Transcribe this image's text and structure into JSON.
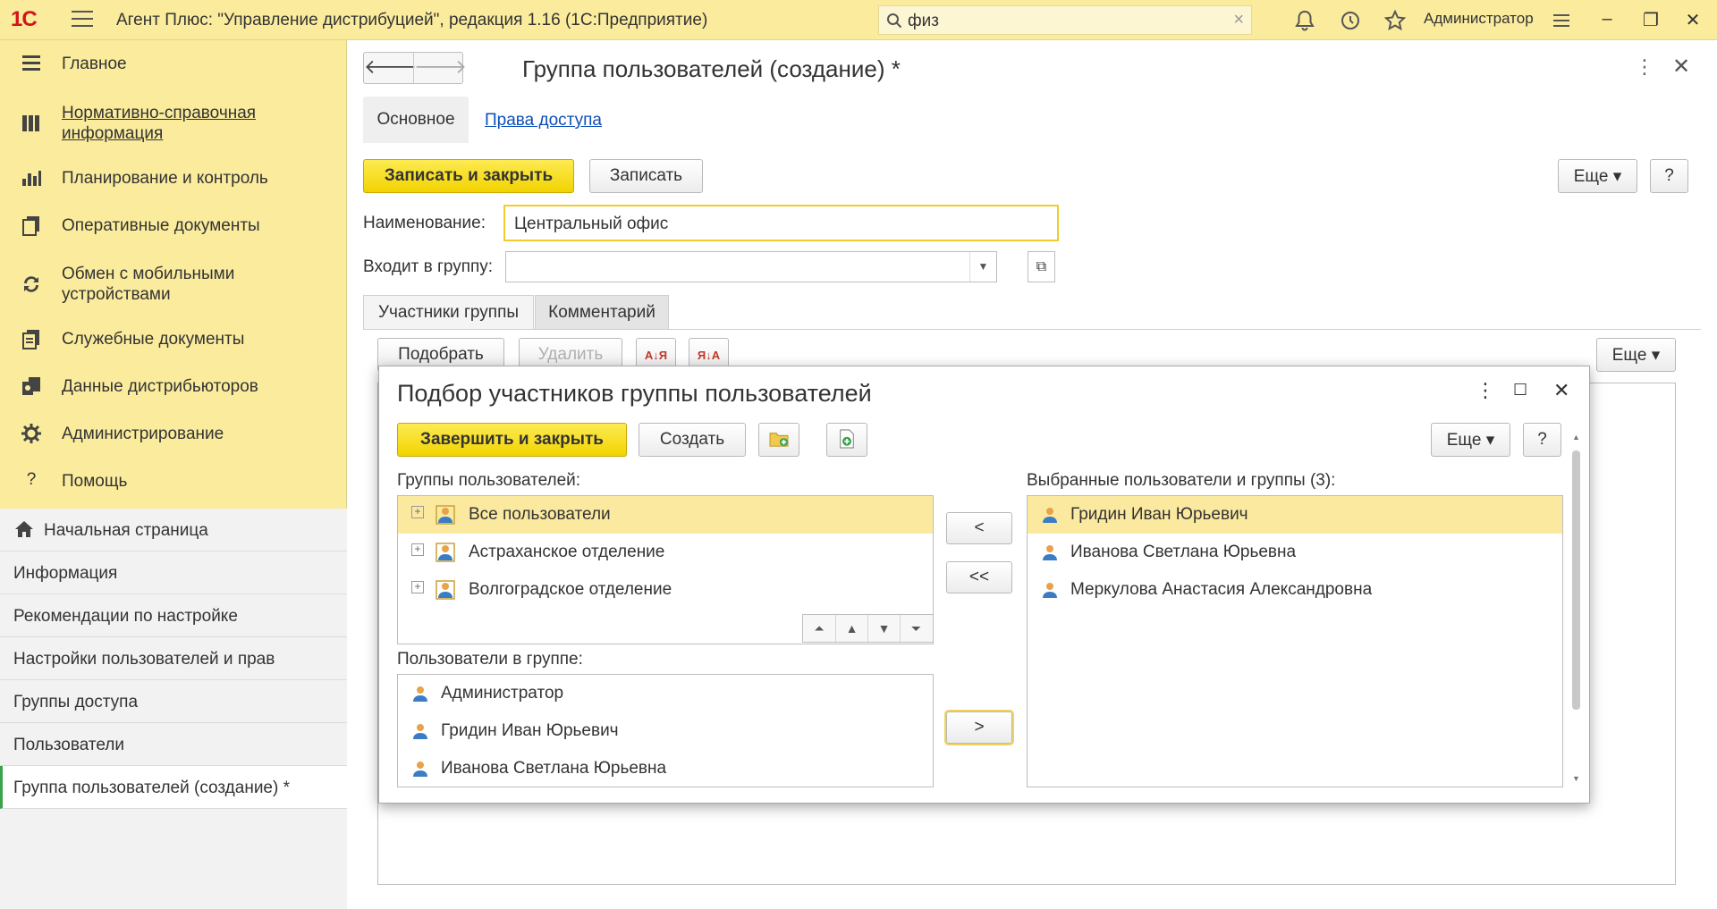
{
  "topbar": {
    "logo": "1С",
    "title": "Агент Плюс: \"Управление дистрибуцией\", редакция 1.16  (1С:Предприятие)",
    "search_value": "физ",
    "user": "Администратор",
    "icons": [
      "bell-icon",
      "history-icon",
      "star-icon",
      "settings-icon"
    ]
  },
  "sidebar": {
    "sections": [
      {
        "label": "Главное",
        "icon": "menu-icon",
        "link": false
      },
      {
        "label": "Нормативно-справочная информация",
        "icon": "catalog-icon",
        "link": true
      },
      {
        "label": "Планирование и контроль",
        "icon": "chart-icon",
        "link": false
      },
      {
        "label": "Оперативные документы",
        "icon": "documents-icon",
        "link": false
      },
      {
        "label": "Обмен с мобильными устройствами",
        "icon": "sync-icon",
        "link": false
      },
      {
        "label": "Служебные документы",
        "icon": "service-docs-icon",
        "link": false
      },
      {
        "label": "Данные дистрибьюторов",
        "icon": "distributors-icon",
        "link": false
      },
      {
        "label": "Администрирование",
        "icon": "gear-icon",
        "link": false
      },
      {
        "label": "Помощь",
        "icon": "help-icon",
        "link": false
      }
    ],
    "open_windows": [
      {
        "label": "Начальная страница"
      },
      {
        "label": "Информация"
      },
      {
        "label": "Рекомендации по настройке"
      },
      {
        "label": "Настройки пользователей и прав"
      },
      {
        "label": "Группы доступа"
      },
      {
        "label": "Пользователи"
      },
      {
        "label": "Группа пользователей (создание) *"
      }
    ]
  },
  "form": {
    "title": "Группа пользователей (создание) *",
    "tabs": [
      {
        "label": "Основное"
      },
      {
        "label": "Права доступа"
      }
    ],
    "save_close_label": "Записать и закрыть",
    "save_label": "Записать",
    "more_label": "Еще",
    "help_label": "?",
    "name_label": "Наименование:",
    "name_value": "Центральный офис",
    "parent_label": "Входит в группу:",
    "parent_value": "",
    "subtabs": [
      {
        "label": "Участники группы"
      },
      {
        "label": "Комментарий"
      }
    ],
    "pick_label": "Подобрать",
    "delete_label": "Удалить",
    "list_more_label": "Еще"
  },
  "dialog": {
    "title": "Подбор участников группы пользователей",
    "finish_label": "Завершить и закрыть",
    "create_label": "Создать",
    "more_label": "Еще",
    "help_label": "?",
    "groups_label": "Группы пользователей:",
    "groups": [
      {
        "label": "Все пользователи"
      },
      {
        "label": "Астраханское отделение"
      },
      {
        "label": "Волгоградское отделение"
      }
    ],
    "users_label": "Пользователи в группе:",
    "users": [
      {
        "label": "Администратор"
      },
      {
        "label": "Гридин Иван Юрьевич"
      },
      {
        "label": "Иванова Светлана Юрьевна"
      }
    ],
    "selected_label": "Выбранные пользователи и группы (3):",
    "selected": [
      {
        "label": "Гридин Иван Юрьевич"
      },
      {
        "label": "Иванова Светлана Юрьевна"
      },
      {
        "label": "Меркулова Анастасия Александровна"
      }
    ],
    "btn_remove_one": "<",
    "btn_remove_all": "<<",
    "btn_add": ">"
  },
  "colors": {
    "accent_yellow": "#f2d300",
    "sidebar_bg": "#fbec9d",
    "selection": "#fbe9a0",
    "link": "#0e4fb8"
  }
}
